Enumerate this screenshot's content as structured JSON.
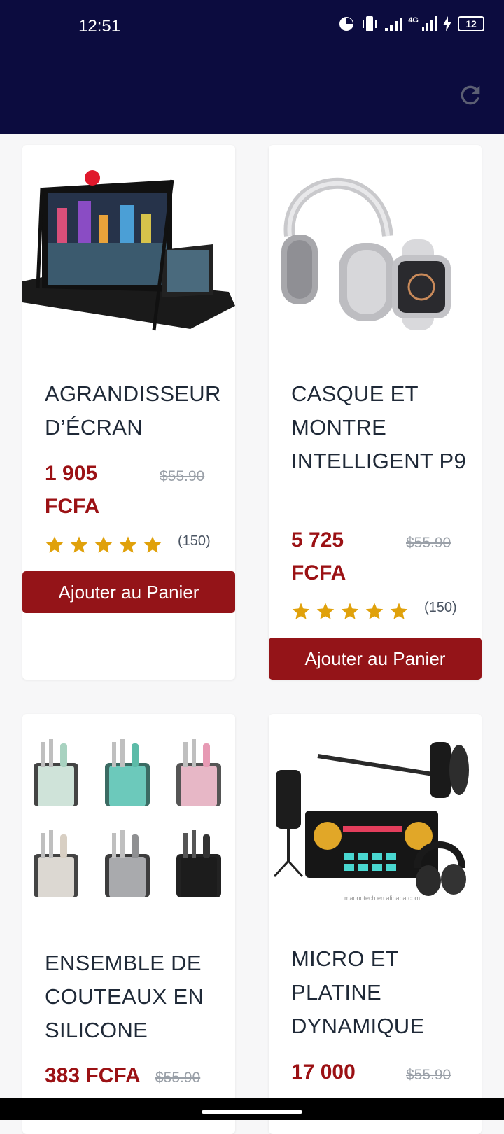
{
  "status": {
    "time": "12:51",
    "network": "4G",
    "battery": "12"
  },
  "products": [
    {
      "title": "AGRANDISSEUR D’ÉCRAN",
      "price": "1 905 FCFA",
      "old_price": "$55.90",
      "rating": 5,
      "reviews": "(150)",
      "button": "Ajouter au Panier"
    },
    {
      "title": "CASQUE ET MONTRE INTELLIGENT P9",
      "price": "5 725 FCFA",
      "old_price": "$55.90",
      "rating": 5,
      "reviews": "(150)",
      "button": "Ajouter au Panier"
    },
    {
      "title": "ENSEMBLE DE COUTEAUX EN SILICONE",
      "price": "383 FCFA",
      "old_price": "$55.90"
    },
    {
      "title": "MICRO ET PLATINE DYNAMIQUE",
      "price": "17 000",
      "old_price": "$55.90",
      "image_caption": "maonotech.en.alibaba.com"
    }
  ],
  "colors": {
    "header": "#0c0c3f",
    "accent": "#941418",
    "price": "#9b1114",
    "star": "#e0a10b"
  },
  "icons": [
    "refresh-icon",
    "star-icon",
    "battery-icon",
    "signal-icon"
  ]
}
